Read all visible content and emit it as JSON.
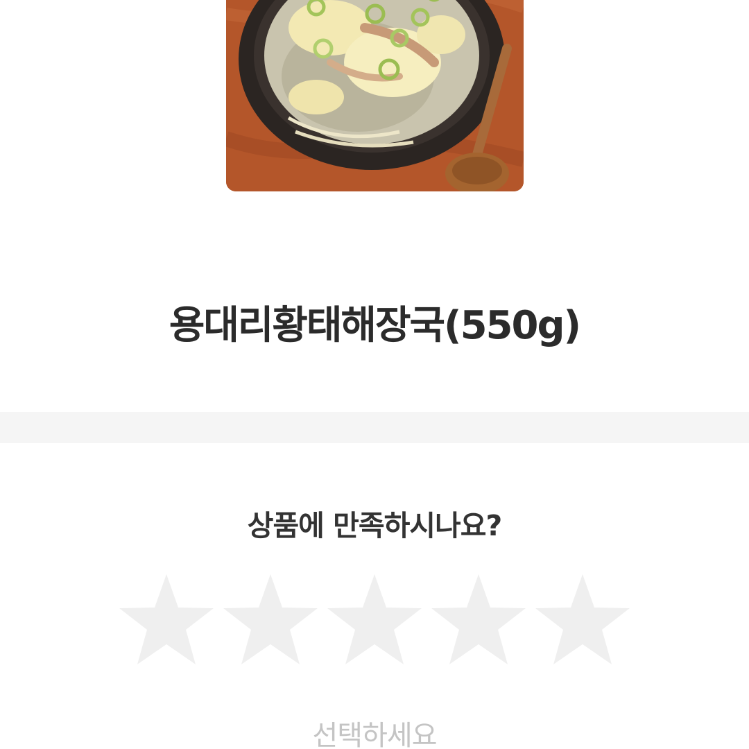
{
  "product": {
    "image_alt": "용대리황태해장국",
    "name": "용대리황태해장국(550g)"
  },
  "review": {
    "question": "상품에 만족하시나요?",
    "rating": 0,
    "max_rating": 5,
    "select_hint": "선택하세요",
    "star_color": "#efefef"
  }
}
